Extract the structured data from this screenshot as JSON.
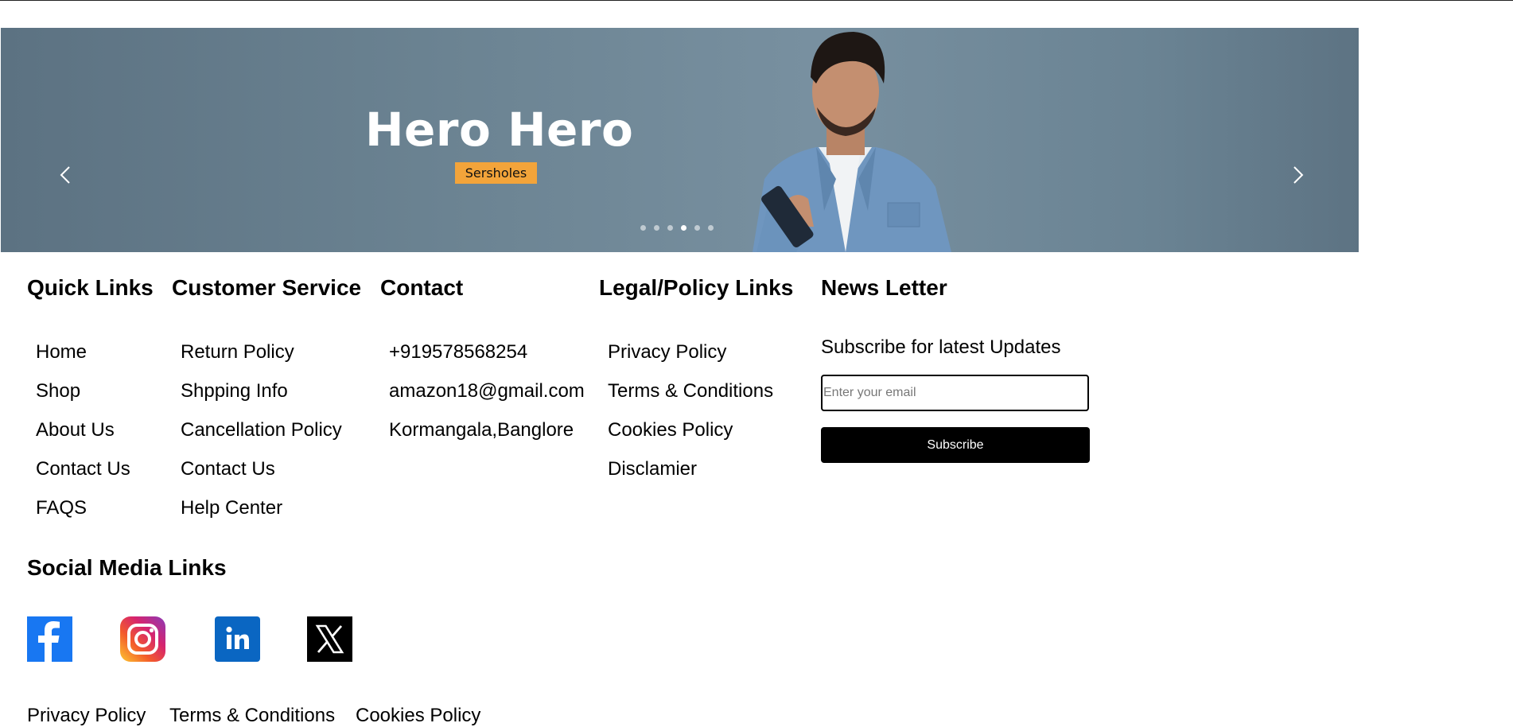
{
  "hero": {
    "title": "Hero Hero",
    "tag": "Sersholes",
    "slide_count": 6,
    "active_slide": 4,
    "prev_icon": "chevron-left-icon",
    "next_icon": "chevron-right-icon"
  },
  "footer": {
    "quick_links": {
      "heading": "Quick Links",
      "items": [
        "Home",
        "Shop",
        "About Us",
        "Contact Us",
        "FAQS"
      ]
    },
    "customer_service": {
      "heading": "Customer Service",
      "items": [
        "Return Policy",
        "Shpping Info",
        "Cancellation Policy",
        "Contact Us",
        "Help Center"
      ]
    },
    "contact": {
      "heading": "Contact",
      "items": [
        "+919578568254",
        "amazon18@gmail.com",
        "Kormangala,Banglore"
      ]
    },
    "legal": {
      "heading": "Legal/Policy Links",
      "items": [
        "Privacy Policy",
        "Terms & Conditions",
        "Cookies Policy",
        "Disclamier"
      ]
    },
    "newsletter": {
      "heading": "News Letter",
      "subtitle": "Subscribe for latest Updates",
      "email_placeholder": "Enter your email",
      "email_value": "",
      "button_label": "Subscribe"
    },
    "social": {
      "heading": "Social Media Links",
      "icons": [
        "facebook-icon",
        "instagram-icon",
        "linkedin-icon",
        "x-icon"
      ]
    },
    "bottom_links": [
      "Privacy Policy",
      "Terms & Conditions",
      "Cookies Policy"
    ]
  },
  "colors": {
    "hero_tag": "#f3a43a",
    "button_bg": "#000000",
    "facebook": "#1877f2",
    "linkedin": "#0a66c2"
  }
}
